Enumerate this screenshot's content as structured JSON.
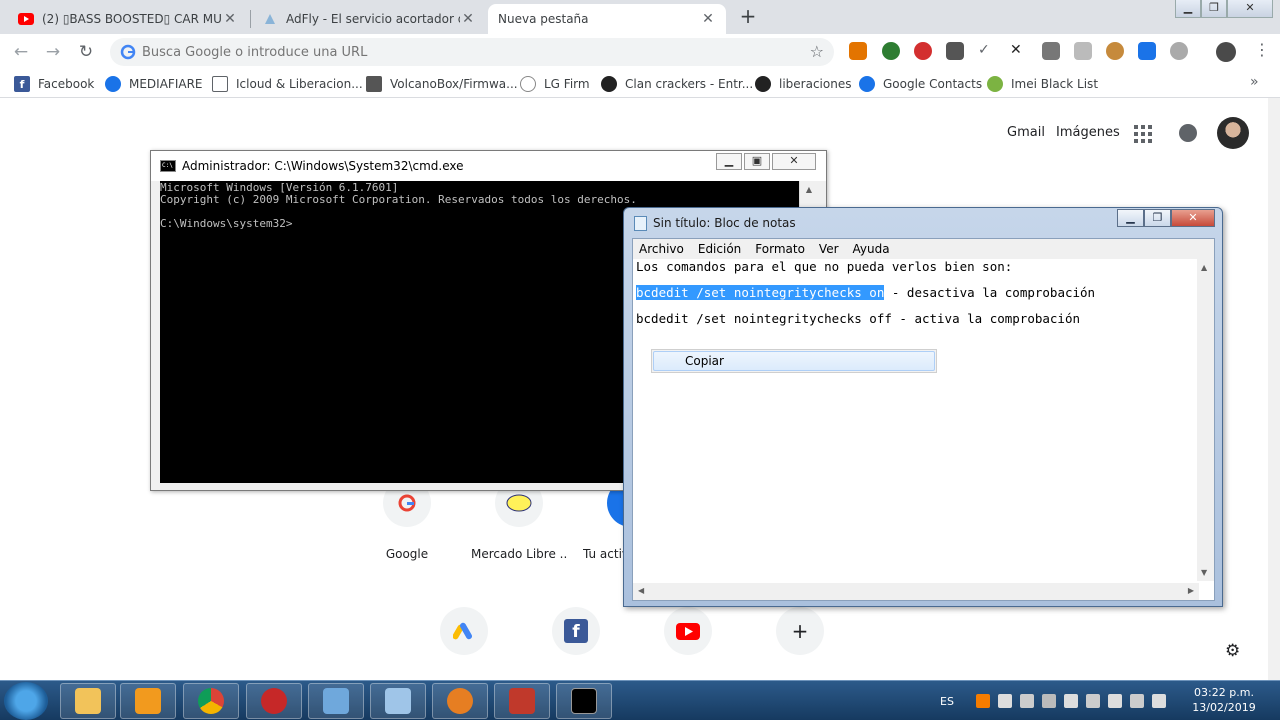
{
  "browser": {
    "tabs": [
      {
        "title": "(2) ▯BASS BOOSTED▯ CAR MUSI",
        "icon": "youtube-icon"
      },
      {
        "title": "AdFly - El servicio acortador de U",
        "icon": "adfly-icon"
      },
      {
        "title": "Nueva pestaña",
        "icon": "none"
      }
    ],
    "omnibox_placeholder": "Busca Google o introduce una URL",
    "bookmarks": [
      {
        "label": "Facebook",
        "icon": "facebook-icon"
      },
      {
        "label": "MEDIAFIARE",
        "icon": "mediafire-icon"
      },
      {
        "label": "Icloud & Liberacion...",
        "icon": "page-icon"
      },
      {
        "label": "VolcanoBox/Firmwa...",
        "icon": "volcano-icon"
      },
      {
        "label": "LG Firm",
        "icon": "lg-icon"
      },
      {
        "label": "Clan crackers - Entr...",
        "icon": "crackers-icon"
      },
      {
        "label": "liberaciones",
        "icon": "circle-icon"
      },
      {
        "label": "Google Contacts",
        "icon": "contacts-icon"
      },
      {
        "label": "Imei Black List",
        "icon": "imei-icon"
      }
    ]
  },
  "ntp": {
    "gmail": "Gmail",
    "images": "Imágenes",
    "tiles_row1": [
      "Google",
      "Mercado Libre ...",
      "Tu activ"
    ]
  },
  "cmd": {
    "title": "Administrador: C:\\Windows\\System32\\cmd.exe",
    "lines": [
      "Microsoft Windows [Versión 6.1.7601]",
      "Copyright (c) 2009 Microsoft Corporation. Reservados todos los derechos.",
      "",
      "C:\\Windows\\system32>"
    ]
  },
  "notepad": {
    "title": "Sin título: Bloc de notas",
    "menu": [
      "Archivo",
      "Edición",
      "Formato",
      "Ver",
      "Ayuda"
    ],
    "line1": "Los comandos para el que no pueda verlos bien son:",
    "line2_selected": "bcdedit /set nointegritychecks on",
    "line2_rest": " - desactiva la comprobación",
    "line3": "bcdedit /set nointegritychecks off - activa la comprobación",
    "context_item": "Copiar"
  },
  "taskbar": {
    "language": "ES",
    "time": "03:22 p.m.",
    "date": "13/02/2019"
  },
  "colors": {
    "selection": "#3399ff",
    "taskbar": "#1f4a78"
  }
}
